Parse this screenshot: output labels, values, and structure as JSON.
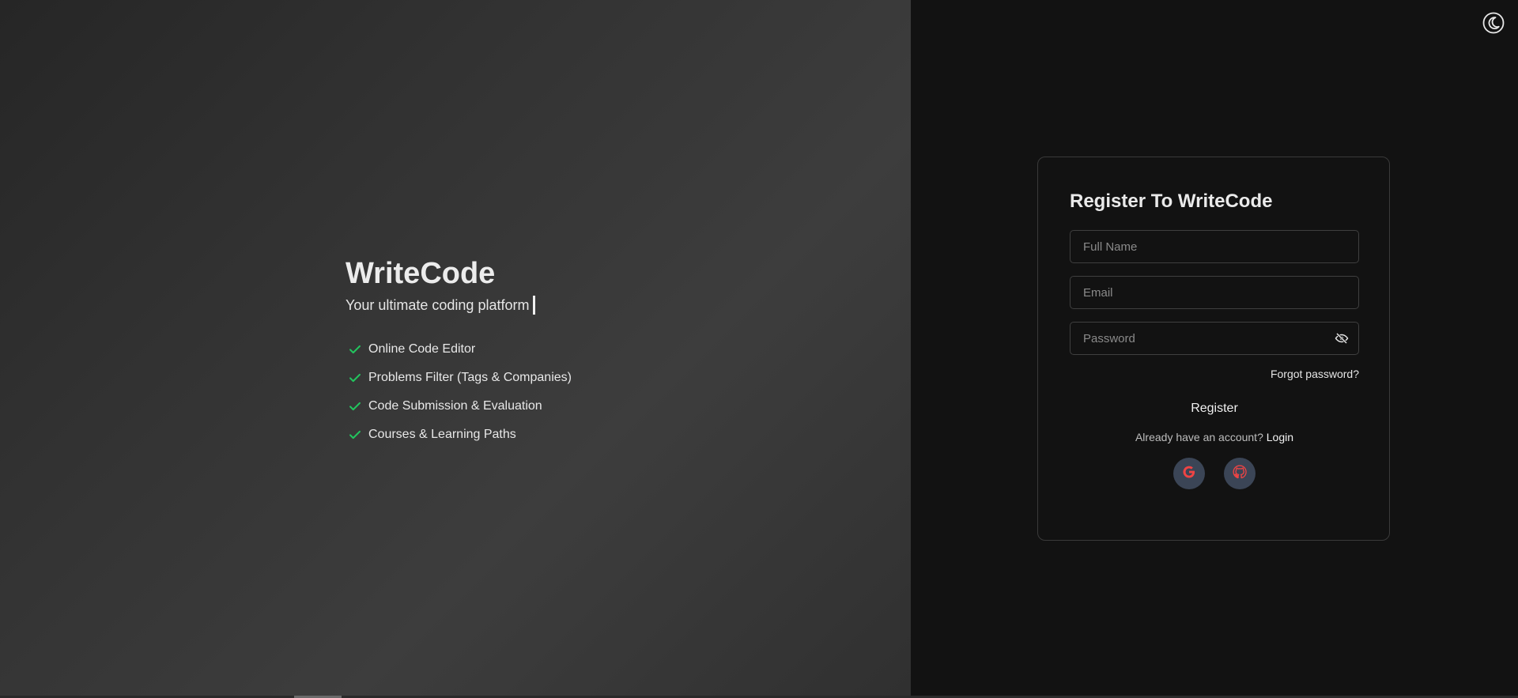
{
  "brand": {
    "title": "WriteCode",
    "subtitle": "Your ultimate coding platform"
  },
  "features": [
    {
      "label": "Online Code Editor",
      "icon": "check-icon"
    },
    {
      "label": "Problems Filter (Tags & Companies)",
      "icon": "check-icon"
    },
    {
      "label": "Code Submission & Evaluation",
      "icon": "check-icon"
    },
    {
      "label": "Courses & Learning Paths",
      "icon": "check-icon"
    }
  ],
  "theme_toggle": {
    "icon": "moon-icon"
  },
  "register_form": {
    "title": "Register To WriteCode",
    "full_name": {
      "placeholder": "Full Name",
      "value": ""
    },
    "email": {
      "placeholder": "Email",
      "value": ""
    },
    "password": {
      "placeholder": "Password",
      "value": "",
      "toggle_icon": "eye-off-icon"
    },
    "forgot_label": "Forgot password?",
    "submit_label": "Register",
    "login_prompt": "Already have an account?",
    "login_label": "Login",
    "social": [
      {
        "icon": "google-icon"
      },
      {
        "icon": "github-icon"
      }
    ]
  },
  "colors": {
    "check": "#22c55e",
    "social_icon": "#ef4444",
    "social_bg": "#3b4556",
    "panel_dark": "#121212"
  }
}
